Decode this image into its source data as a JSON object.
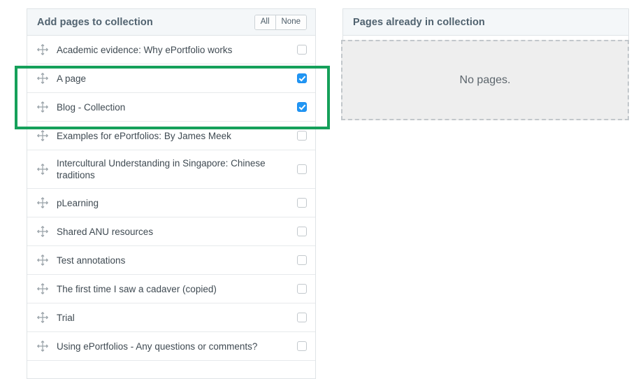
{
  "left_panel": {
    "title": "Add pages to collection",
    "select_all_label": "All",
    "select_none_label": "None",
    "drag_handle_icon": "move-arrows-icon",
    "rows": [
      {
        "label": "Academic evidence: Why ePortfolio works",
        "checked": false
      },
      {
        "label": "A page",
        "checked": true
      },
      {
        "label": "Blog - Collection",
        "checked": true
      },
      {
        "label": "Examples for ePortfolios: By James Meek",
        "checked": false
      },
      {
        "label": "Intercultural Understanding in Singapore: Chinese traditions",
        "checked": false,
        "two_line": true
      },
      {
        "label": "pLearning",
        "checked": false
      },
      {
        "label": "Shared ANU resources",
        "checked": false
      },
      {
        "label": "Test annotations",
        "checked": false
      },
      {
        "label": "The first time I saw a cadaver (copied)",
        "checked": false
      },
      {
        "label": "Trial",
        "checked": false
      },
      {
        "label": "Using ePortfolios - Any questions or comments?",
        "checked": false
      }
    ]
  },
  "right_panel": {
    "title": "Pages already in collection",
    "empty_message": "No pages."
  },
  "annotation": {
    "highlight_color": "#15a05a"
  },
  "colors": {
    "header_background": "#f4f7f9",
    "header_text": "#50626f",
    "border": "#dfe3e6",
    "row_text": "#3f4a52",
    "checkbox_checked": "#2196f3",
    "dropzone_background": "#eeeeee",
    "dropzone_border": "#c2c7cb"
  }
}
